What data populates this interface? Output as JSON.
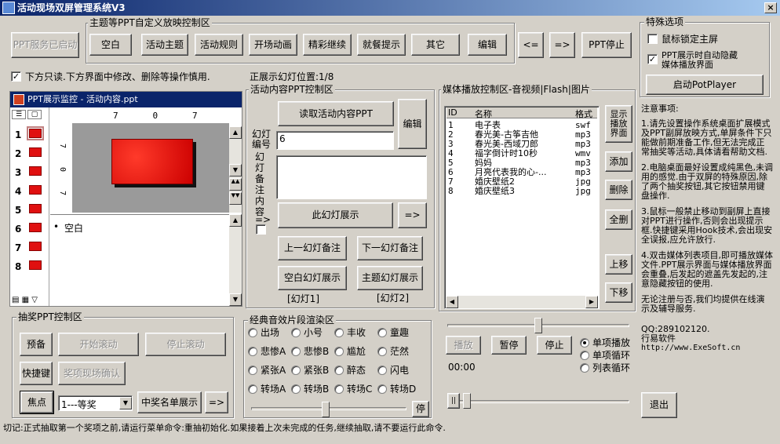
{
  "window": {
    "title": "活动现场双屏管理系统V3",
    "close": "×"
  },
  "ppt_service_button": "PPT服务已启动",
  "theme_group": {
    "title": "主题等PPT自定义放映控制区",
    "buttons": [
      "空白",
      "活动主题",
      "活动规则",
      "开场动画",
      "精彩继续",
      "就餐提示",
      "其它"
    ],
    "edit": "编辑"
  },
  "nav": {
    "prev": "<=",
    "next": "=>",
    "stop": "PPT停止"
  },
  "special": {
    "title": "特殊选项",
    "lock_mouse": "鼠标锁定主屏",
    "auto_hide": "PPT展示时自动隐藏媒体播放界面",
    "lock_checked": false,
    "autohide_checked": true,
    "potplayer": "启动PotPlayer"
  },
  "readonly_check": {
    "label": "下方只读.下方界面中修改、删除等操作慎用.",
    "checked": true
  },
  "position": {
    "label": "正展示幻灯位置:1/8"
  },
  "ppt_monitor": {
    "title": "PPT展示监控 - 活动内容.ppt",
    "slide_numbers": [
      "1",
      "2",
      "3",
      "4",
      "5",
      "6",
      "7",
      "8"
    ],
    "ruler_top": "7   0   7",
    "ruler_left": "7  0  7",
    "notes_text": "空白"
  },
  "content_group": {
    "title": "活动内容PPT控制区",
    "read_button": "读取活动内容PPT",
    "edit": "编辑",
    "slide_no_label": "幻灯编号",
    "slide_no_value": "6",
    "notes_label": "幻灯备注内容",
    "arrow": "=>",
    "show_button": "此幻灯展示",
    "arrow_button": "=>",
    "prev_note": "上一幻灯备注",
    "next_note": "下一幻灯备注",
    "blank_show": "空白幻灯展示",
    "theme_show": "主题幻灯展示",
    "tag1": "[幻灯1]",
    "tag2": "[幻灯2]"
  },
  "media_group": {
    "title": "媒体播放控制区-音视频|Flash|图片",
    "headers": {
      "id": "ID",
      "name": "名称",
      "format": "格式"
    },
    "rows": [
      {
        "id": "1",
        "name": "电子表",
        "format": "swf"
      },
      {
        "id": "2",
        "name": "春光美-古筝吉他",
        "format": "mp3"
      },
      {
        "id": "3",
        "name": "春光美-西域刀郎",
        "format": "mp3"
      },
      {
        "id": "4",
        "name": "福字倒计时10秒",
        "format": "wmv"
      },
      {
        "id": "5",
        "name": "妈妈",
        "format": "mp3"
      },
      {
        "id": "6",
        "name": "月亮代表我的心-...",
        "format": "mp3"
      },
      {
        "id": "7",
        "name": "婚庆壁纸2",
        "format": "jpg"
      },
      {
        "id": "8",
        "name": "婚庆壁纸3",
        "format": "jpg"
      }
    ],
    "show_panel": "显示播放界面",
    "add": "添加",
    "delete": "删除",
    "clear": "全删",
    "up": "上移",
    "down": "下移",
    "play": "播放",
    "pause": "暂停",
    "stop": "停止",
    "time": "00:00",
    "modes": [
      "单项播放",
      "单项循环",
      "列表循环"
    ],
    "pause_char": "||"
  },
  "notes_panel": {
    "title": "注意事项:",
    "items": [
      "1.请先设置操作系统桌面扩展模式及PPT副屏放映方式,单屏条件下只能做前期准备工作,但无法完成正常抽奖等活动,具体请看帮助文档.",
      "2.电脑桌面最好设置成纯黑色,未调用的感觉.由于双屏的特殊原因,除了两个抽奖按钮,其它按钮禁用键盘操作.",
      "3.鼠标一般禁止移动到副屏上直接对PPT进行操作,否则会出现提示框.快捷键采用Hook技术,会出现安全误报,应允许放行.",
      "4.双击媒体列表项目,即可播放媒体文件.PPT展示界面与媒体播放界面会重叠,后发起的遮盖先发起的,注意隐藏按钮的使用."
    ],
    "service": "无论注册与否,我们均提供在线演示及辅导服务.",
    "qq": "QQ:289102120.",
    "company": "行易软件",
    "url": "http://www.ExeSoft.cn",
    "exit": "退出"
  },
  "lottery": {
    "title": "抽奖PPT控制区",
    "prepare": "预备",
    "start": "开始滚动",
    "stop": "停止滚动",
    "shortcut": "快捷键",
    "confirm": "奖项现场确认",
    "focus": "焦点",
    "prize": "1---等奖",
    "winners": "中奖名单展示",
    "arrow": "=>"
  },
  "sound": {
    "title": "经典音效片段渲染区",
    "options": [
      "出场",
      "小号",
      "丰收",
      "童趣",
      "悲惨A",
      "悲惨B",
      "尴尬",
      "茫然",
      "紧张A",
      "紧张B",
      "醉态",
      "闪电",
      "转场A",
      "转场B",
      "转场C",
      "转场D"
    ],
    "stop": "停"
  },
  "status": "切记:正式抽取第一个奖项之前,请运行菜单命令:重抽初始化.如果接着上次未完成的任务,继续抽取,请不要运行此命令."
}
